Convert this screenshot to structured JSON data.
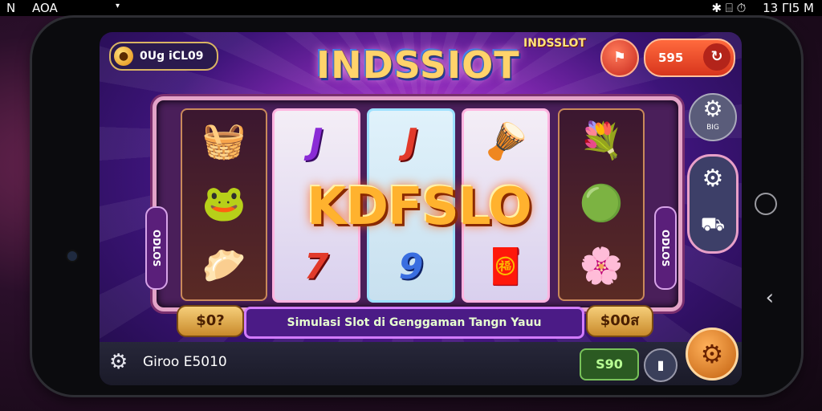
{
  "status_bar": {
    "left_text": "N",
    "carrier": "AOA",
    "right_icons_text": "✱  ⌸  ⏱",
    "time": "13 ΓΙ5 M"
  },
  "header": {
    "coin_label": "0Ug iCL09",
    "game_title": "INDSSIOT",
    "brand_tag": "INDSSLOT",
    "balance": "595"
  },
  "reels": {
    "reel2_top": "J",
    "reel2_bottom": "7",
    "reel3_top": "J",
    "reel3_bottom": "9",
    "big_logo": "KDFSLO",
    "left_tag": "ODLOS",
    "right_tag": "ODLOS"
  },
  "info_row": {
    "left_win": "$0?",
    "banner_text": "Simulasi Slot di Genggaman Tangn Yauu",
    "right_win": "$00ส"
  },
  "side_controls": {
    "settings_label": "BIG"
  },
  "footer": {
    "player_name": "Giroo E5010",
    "bet": "S90"
  },
  "icons": [
    "coin-icon",
    "share-icon",
    "refresh-icon",
    "gear-icon",
    "settings-gear-icon",
    "controller-icon",
    "spin-icon",
    "home-icon",
    "back-icon"
  ]
}
